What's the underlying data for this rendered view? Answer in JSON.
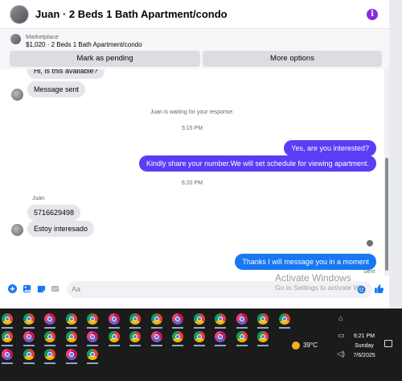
{
  "header": {
    "title": "Juan · 2 Beds 1 Bath Apartment/condo"
  },
  "marketplace": {
    "label": "Marketplace",
    "listing": "$1,020 · 2 Beds 1 Bath Apartment/condo",
    "mark_pending": "Mark as pending",
    "more_options": "More options"
  },
  "messages": {
    "partial_top": "Hi, is this available?",
    "sent_auto": "Message sent",
    "waiting": "Juan is waiting for your response.",
    "time1": "5:15 PM",
    "out1": "Yes, are you interested?",
    "out2": "Kindly share your number.We will set schedule for viewing apartment.",
    "time2": "6:20 PM",
    "sender": "Juan",
    "in1": "5716629498",
    "in2": "Estoy interesado",
    "out3": "Thanks I will message you in a moment",
    "status": "Sent"
  },
  "composer": {
    "placeholder": "Aa"
  },
  "watermark": {
    "title": "Activate Windows",
    "subtitle": "Go to Settings to activate Windows."
  },
  "tray": {
    "temp": "39°C",
    "time": "6:21 PM",
    "day": "Sunday",
    "date": "7/6/2025"
  },
  "colors": {
    "accent": "#5b3df5",
    "messenger_blue": "#1877f2",
    "chrome": "#db4437"
  }
}
